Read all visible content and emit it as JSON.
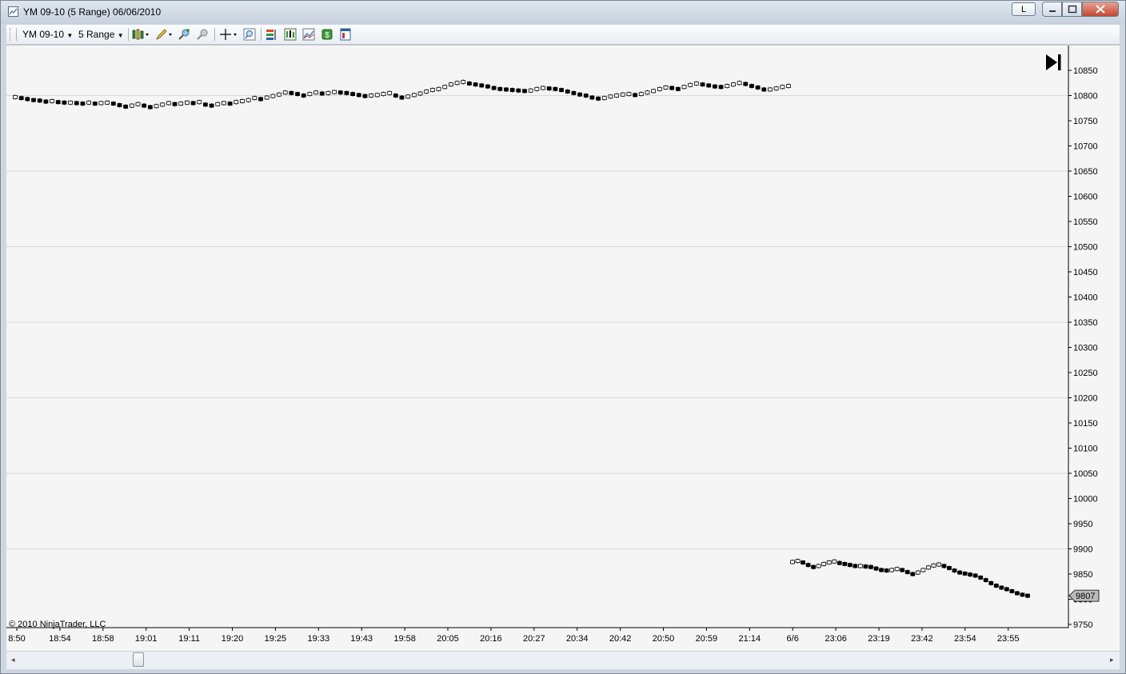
{
  "window": {
    "title": "YM 09-10 (5 Range)  06/06/2010",
    "layout_button": "L"
  },
  "toolbar": {
    "instrument": "YM 09-10",
    "interval": "5 Range",
    "icons": [
      "bar-type-icon",
      "drawing-pencil-icon",
      "zoom-in-icon",
      "zoom-out-icon",
      "crosshair-icon",
      "magnifier-icon",
      "strategies-icon",
      "indicators-icon",
      "chart-style-icon",
      "dollar-icon",
      "properties-icon"
    ]
  },
  "chart": {
    "copyright": "© 2010 NinjaTrader, LLC",
    "price_label": "9807",
    "go_to_end": "go-to-end-icon"
  },
  "chart_data": {
    "type": "line",
    "y_ticks": [
      "10850",
      "10800",
      "10750",
      "10700",
      "10650",
      "10600",
      "10550",
      "10500",
      "10450",
      "10400",
      "10350",
      "10300",
      "10250",
      "10200",
      "10150",
      "10100",
      "10050",
      "10000",
      "9950",
      "9900",
      "9850",
      "9800",
      "9750"
    ],
    "x_ticks": [
      "8:50",
      "18:54",
      "18:58",
      "19:01",
      "19:11",
      "19:20",
      "19:25",
      "19:33",
      "19:43",
      "19:58",
      "20:05",
      "20:16",
      "20:27",
      "20:34",
      "20:42",
      "20:50",
      "20:59",
      "21:14",
      "6/6",
      "23:06",
      "23:19",
      "23:42",
      "23:54",
      "23:55"
    ],
    "ylim": [
      9740,
      10895
    ],
    "grid": true,
    "session1_values": [
      10797,
      10795,
      10793,
      10791,
      10790,
      10788,
      10789,
      10787,
      10786,
      10786,
      10785,
      10784,
      10786,
      10784,
      10785,
      10786,
      10784,
      10781,
      10778,
      10780,
      10783,
      10780,
      10777,
      10779,
      10782,
      10785,
      10783,
      10784,
      10786,
      10785,
      10787,
      10782,
      10780,
      10783,
      10785,
      10784,
      10787,
      10789,
      10791,
      10795,
      10793,
      10796,
      10799,
      10802,
      10806,
      10805,
      10803,
      10800,
      10803,
      10806,
      10804,
      10805,
      10807,
      10806,
      10805,
      10803,
      10801,
      10799,
      10800,
      10801,
      10803,
      10805,
      10800,
      10796,
      10798,
      10801,
      10804,
      10808,
      10811,
      10813,
      10817,
      10822,
      10825,
      10827,
      10824,
      10822,
      10820,
      10818,
      10815,
      10813,
      10812,
      10811,
      10810,
      10809,
      10810,
      10813,
      10815,
      10814,
      10813,
      10811,
      10808,
      10805,
      10802,
      10800,
      10796,
      10794,
      10795,
      10798,
      10800,
      10802,
      10803,
      10801,
      10803,
      10806,
      10809,
      10813,
      10816,
      10815,
      10813,
      10817,
      10821,
      10824,
      10822,
      10820,
      10818,
      10817,
      10819,
      10822,
      10825,
      10823,
      10819,
      10816,
      10812,
      10812,
      10814,
      10817,
      10819
    ],
    "session2_values": [
      9874,
      9876,
      9873,
      9868,
      9864,
      9866,
      9870,
      9873,
      9875,
      9872,
      9870,
      9868,
      9866,
      9866,
      9865,
      9864,
      9861,
      9858,
      9857,
      9858,
      9860,
      9858,
      9854,
      9850,
      9853,
      9858,
      9863,
      9867,
      9869,
      9866,
      9862,
      9857,
      9853,
      9851,
      9849,
      9847,
      9843,
      9838,
      9832,
      9827,
      9823,
      9820,
      9816,
      9812,
      9809,
      9807
    ]
  }
}
